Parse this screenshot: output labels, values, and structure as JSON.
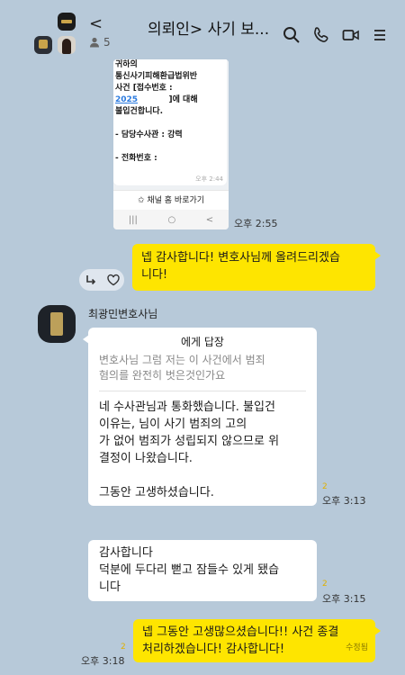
{
  "header": {
    "back": "<",
    "title": "의뢰인> 사기 보...",
    "member_count": "5"
  },
  "screenshot": {
    "lines": [
      "귀하의",
      "통신사기피해환급법위반",
      "사건 [접수번호 :",
      "2025",
      "]에 대해",
      "불입건합니다.",
      "",
      "- 담당수사관 : 강력",
      "",
      "- 전화번호 :"
    ],
    "small_time": "오후 2:44",
    "link_label": "✩ 채널 홈 바로가기",
    "nav": [
      "|||",
      "○",
      "<"
    ]
  },
  "messages": {
    "m1_time": "오후 2:55",
    "m2_text_1": "넵 감사합니다! 변호사님께 올려드리겠습",
    "m2_text_2": "니다!",
    "sender_name": "최광민변호사님",
    "reply_head": "에게 답장",
    "quote_1": "변호사님 그럼 저는 이 사건에서 범죄",
    "quote_2": "혐의를 완전히 벗은것인가요",
    "reply_1": "네 수사관님과 통화했습니다. 불입건",
    "reply_2": "이유는,           님이 사기 범죄의 고의",
    "reply_3": "가 없어 범죄가 성립되지 않으므로 위",
    "reply_4": "결정이 나왔습니다.",
    "reply_5": "그동안 고생하셨습니다.",
    "reply_unread": "2",
    "reply_time": "오후 3:13",
    "thanks_1": "감사합니다",
    "thanks_2": "덕분에 두다리 뻗고 잠들수 있게 됐습",
    "thanks_3": "니다",
    "thanks_unread": "2",
    "thanks_time": "오후 3:15",
    "last_1": "넵 그동안 고생많으셨습니다!! 사건 종결",
    "last_2": "처리하겠습니다! 감사합니다!",
    "last_edited": "수정됨",
    "last_unread": "2",
    "last_time": "오후 3:18"
  }
}
